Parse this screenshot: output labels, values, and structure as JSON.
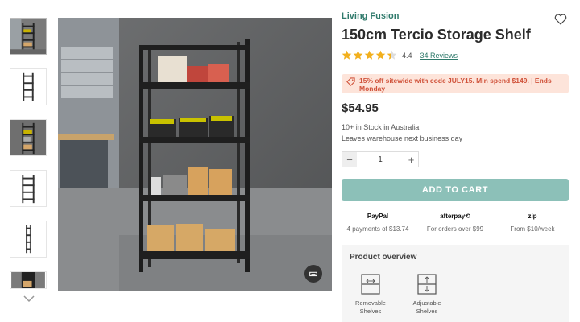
{
  "thumbnails": [
    {
      "name": "thumbnail-1"
    },
    {
      "name": "thumbnail-2"
    },
    {
      "name": "thumbnail-3"
    },
    {
      "name": "thumbnail-4"
    },
    {
      "name": "thumbnail-5"
    },
    {
      "name": "thumbnail-6"
    }
  ],
  "product": {
    "brand": "Living Fusion",
    "title": "150cm Tercio Storage Shelf",
    "rating": 4.4,
    "rating_label": "4.4",
    "reviews_label": "34 Reviews",
    "promo_text": "15% off sitewide with code JULY15. Min spend $149. | Ends Monday",
    "price": "$54.95",
    "stock": "10+ in Stock in Australia",
    "shipping": "Leaves warehouse next business day",
    "quantity": "1",
    "add_to_cart": "ADD TO CART"
  },
  "payments": [
    {
      "logo": "PayPal",
      "sub": "4 payments of $13.74"
    },
    {
      "logo": "afterpay⟲",
      "sub": "For orders over $99"
    },
    {
      "logo": "zip",
      "sub": "From $10/week"
    }
  ],
  "overview": {
    "heading": "Product overview",
    "features": [
      {
        "label": "Removable Shelves",
        "icon": "removable-shelves-icon"
      },
      {
        "label": "Adjustable Shelves",
        "icon": "adjustable-shelves-icon"
      }
    ]
  },
  "colors": {
    "accent": "#2f7a6b",
    "button": "#8cc0b8",
    "promo_bg": "#fde4da",
    "promo_text": "#d0523a",
    "star": "#f2b01e"
  }
}
